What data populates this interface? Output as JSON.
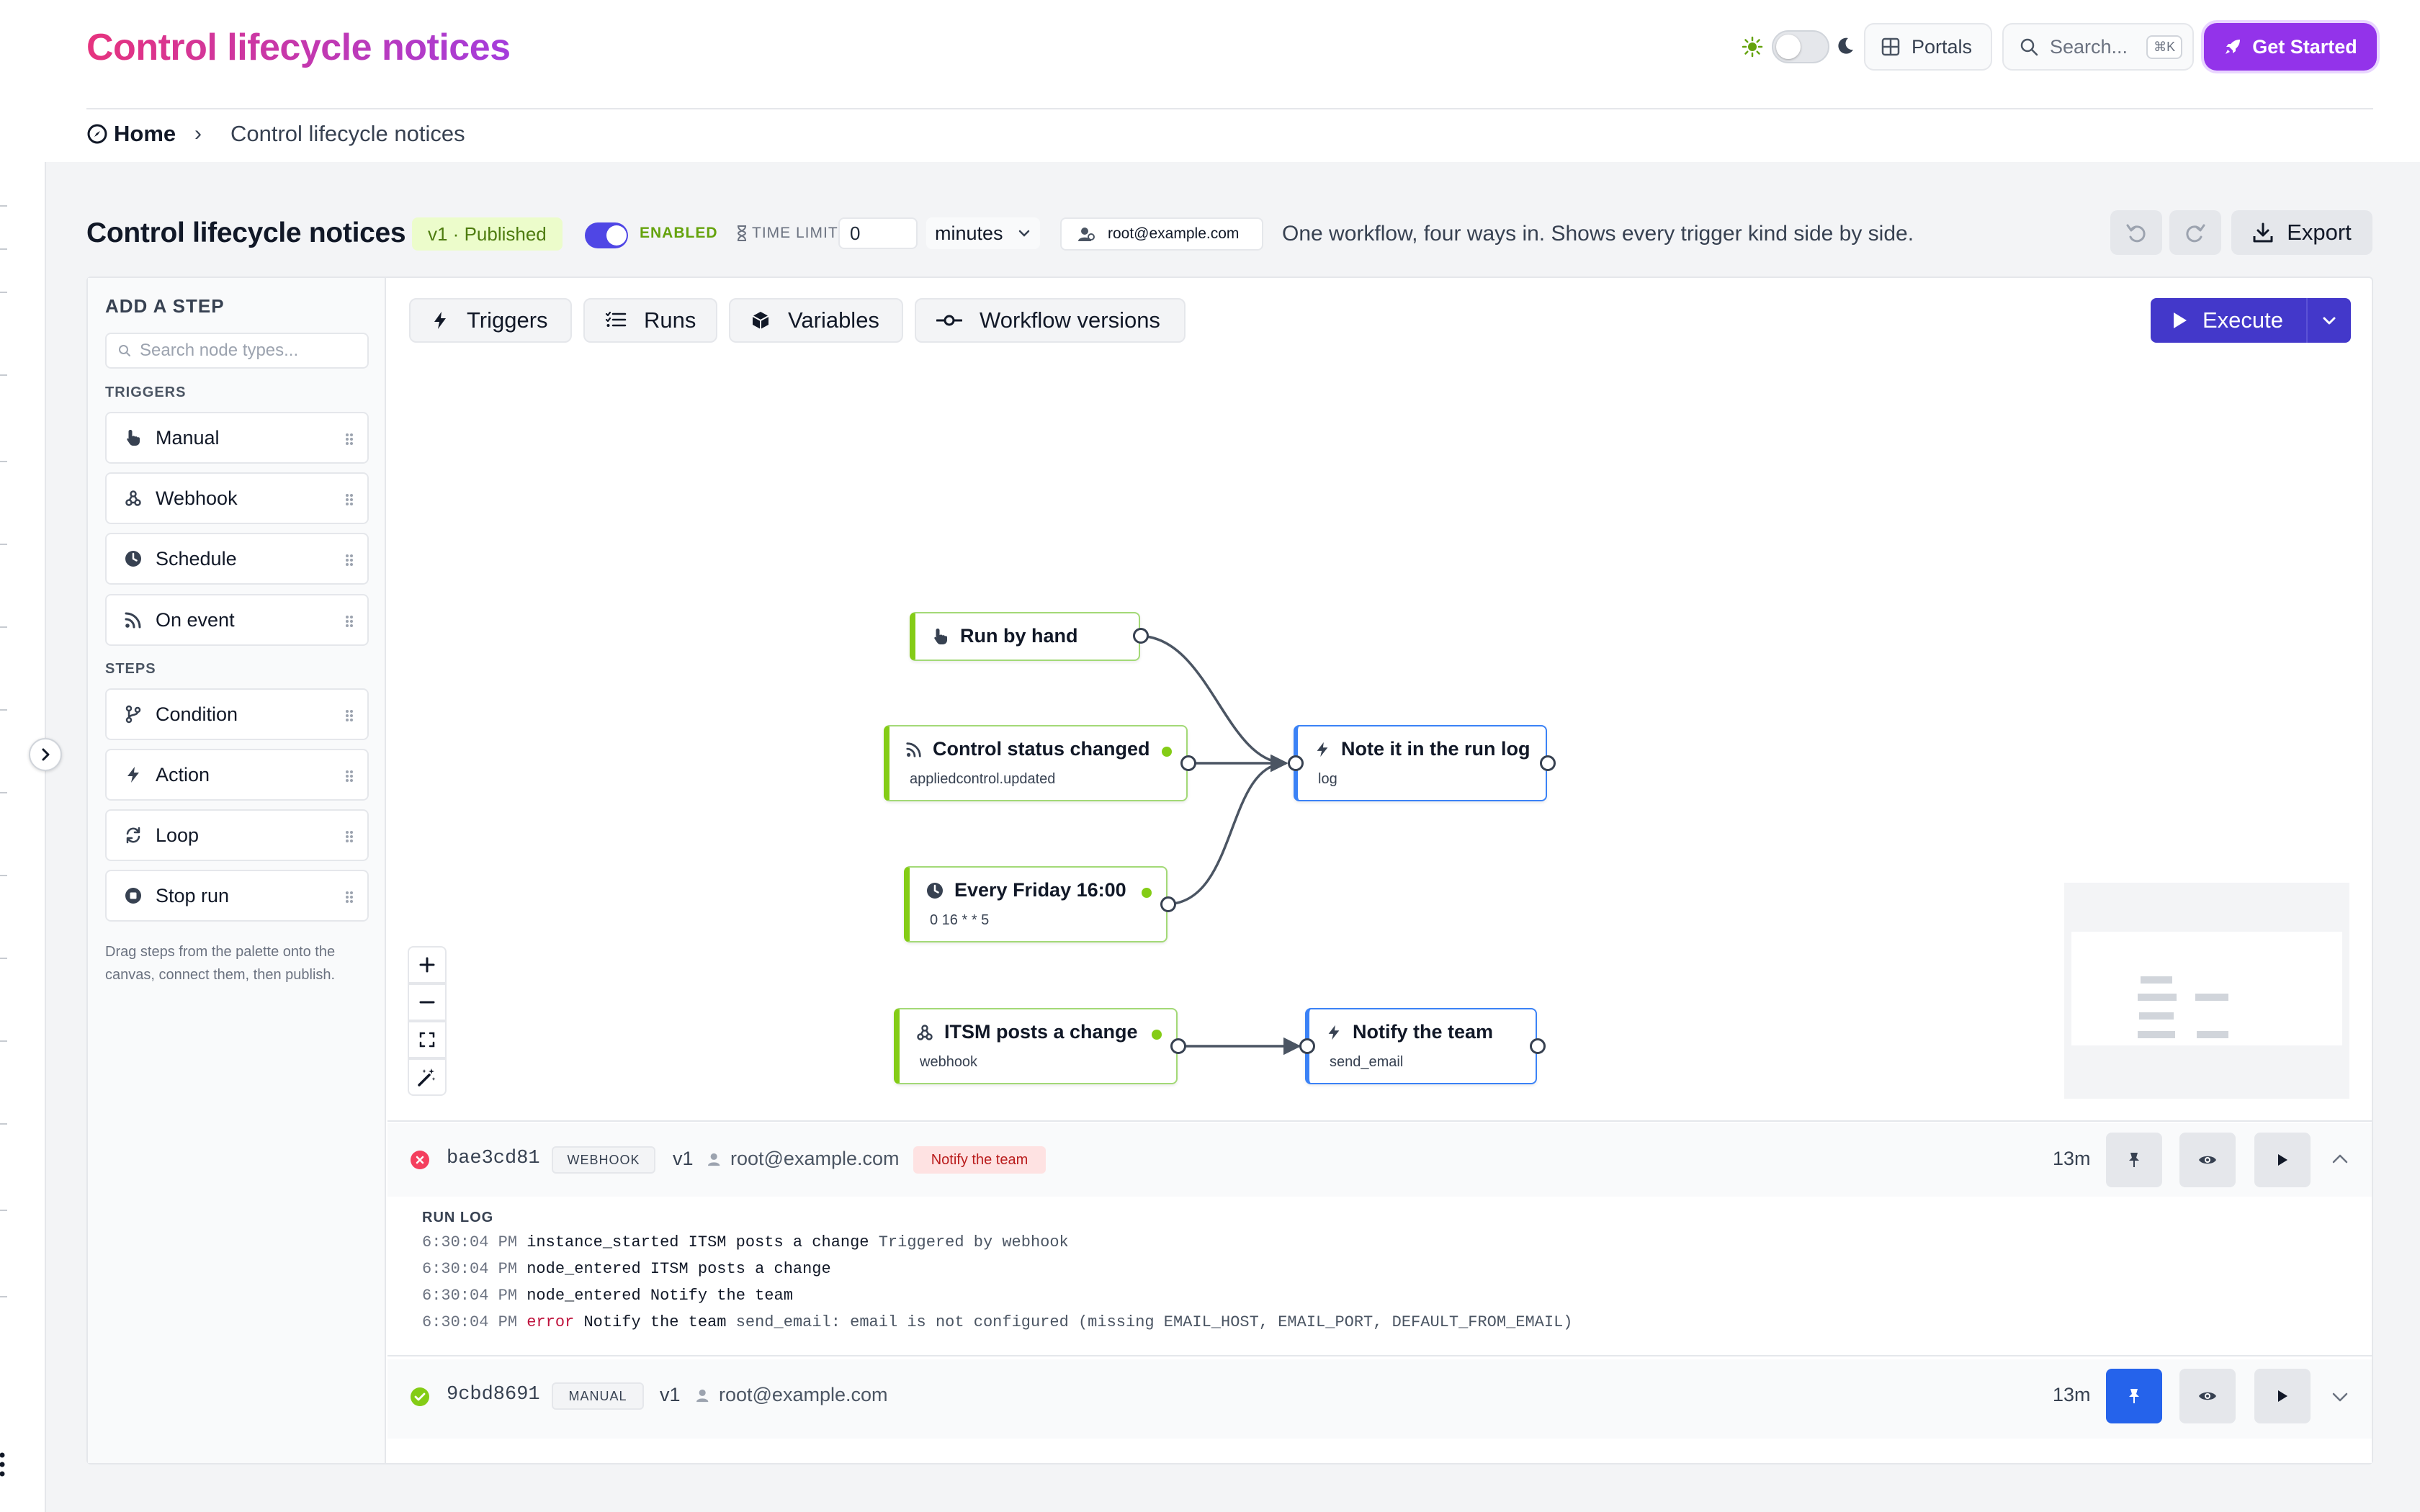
{
  "header": {
    "title": "Control lifecycle notices",
    "portals_label": "Portals",
    "search_placeholder": "Search...",
    "search_shortcut": "⌘K",
    "cta_label": "Get Started"
  },
  "breadcrumb": {
    "home": "Home",
    "separator": "›",
    "current": "Control lifecycle notices"
  },
  "workflow": {
    "title": "Control lifecycle notices",
    "version_badge": "v1 · Published",
    "enabled_label": "ENABLED",
    "enabled": true,
    "time_limit_label": "TIME LIMIT",
    "time_limit_value": "0",
    "time_unit": "minutes",
    "owner": "root@example.com",
    "description": "One workflow, four ways in. Shows every trigger kind side by side.",
    "export_label": "Export"
  },
  "palette": {
    "heading": "ADD A STEP",
    "search_placeholder": "Search node types...",
    "triggers_label": "TRIGGERS",
    "triggers": [
      {
        "label": "Manual",
        "icon": "hand-pointer-icon"
      },
      {
        "label": "Webhook",
        "icon": "webhook-icon"
      },
      {
        "label": "Schedule",
        "icon": "clock-icon"
      },
      {
        "label": "On event",
        "icon": "rss-icon"
      }
    ],
    "steps_label": "STEPS",
    "steps": [
      {
        "label": "Condition",
        "icon": "branch-icon"
      },
      {
        "label": "Action",
        "icon": "bolt-icon"
      },
      {
        "label": "Loop",
        "icon": "loop-icon"
      },
      {
        "label": "Stop run",
        "icon": "stop-icon"
      }
    ],
    "hint": "Drag steps from the palette onto the canvas, connect them, then publish."
  },
  "canvas_tabs": [
    "Triggers",
    "Runs",
    "Variables",
    "Workflow versions"
  ],
  "execute_label": "Execute",
  "nodes": {
    "run_by_hand": {
      "title": "Run by hand"
    },
    "control_status": {
      "title": "Control status changed",
      "sub": "appliedcontrol.updated"
    },
    "every_friday": {
      "title": "Every Friday 16:00",
      "sub": "0 16 * * 5"
    },
    "itsm": {
      "title": "ITSM posts a change",
      "sub": "webhook"
    },
    "note_log": {
      "title": "Note it in the run log",
      "sub": "log"
    },
    "notify_team": {
      "title": "Notify the team",
      "sub": "send_email"
    }
  },
  "runs": [
    {
      "id": "bae3cd81",
      "kind": "WEBHOOK",
      "version": "v1",
      "owner": "root@example.com",
      "step": "Notify the team",
      "status": "error",
      "age": "13m",
      "expanded": true,
      "log_heading": "RUN LOG",
      "log": [
        {
          "time": "6:30:04 PM",
          "event": "instance_started",
          "node": "ITSM posts a change",
          "detail": "Triggered by webhook"
        },
        {
          "time": "6:30:04 PM",
          "event": "node_entered",
          "node": "ITSM posts a change",
          "detail": ""
        },
        {
          "time": "6:30:04 PM",
          "event": "node_entered",
          "node": "Notify the team",
          "detail": ""
        },
        {
          "time": "6:30:04 PM",
          "event": "error",
          "node": "Notify the team",
          "detail": "send_email: email is not configured (missing EMAIL_HOST, EMAIL_PORT, DEFAULT_FROM_EMAIL)"
        }
      ]
    },
    {
      "id": "9cbd8691",
      "kind": "MANUAL",
      "version": "v1",
      "owner": "root@example.com",
      "status": "success",
      "age": "13m",
      "pinned": true,
      "expanded": false
    }
  ],
  "colors": {
    "accent": "#4338ca",
    "trigger_border": "#84cc16",
    "action_border": "#2563eb",
    "error": "#e11d48",
    "success": "#84cc16",
    "cta": "#9333ea"
  }
}
